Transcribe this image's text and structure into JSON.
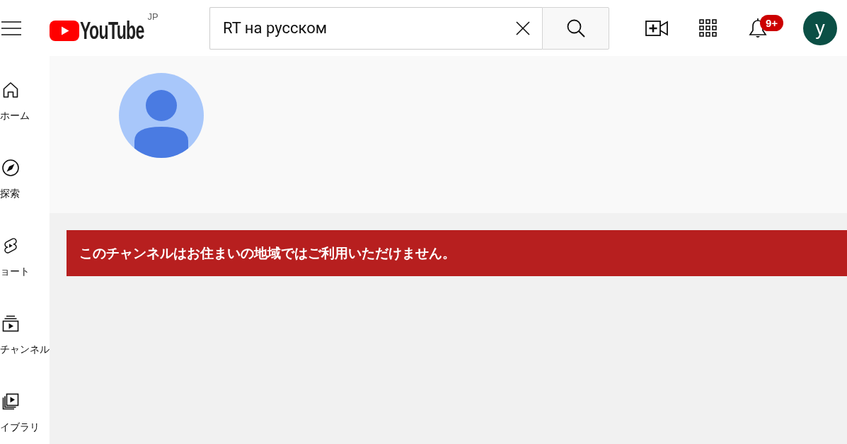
{
  "header": {
    "logo": {
      "text": "YouTube",
      "region": "JP"
    },
    "search": {
      "value": "RT на русском"
    },
    "notifications": {
      "badge": "9+"
    },
    "account": {
      "initial": "y"
    }
  },
  "sidebar": {
    "items": [
      {
        "kind": "home",
        "label": "ホーム",
        "selected": false
      },
      {
        "kind": "explore",
        "label": "探索",
        "selected": false
      },
      {
        "kind": "shorts",
        "label": "ョート",
        "selected": false
      },
      {
        "kind": "subscriptions",
        "label": "チャンネル",
        "selected": false
      },
      {
        "kind": "library",
        "label": "イブラリ",
        "selected": false
      }
    ]
  },
  "channel": {
    "notice": "このチャンネルはお住まいの地域ではご利用いただけません。"
  }
}
